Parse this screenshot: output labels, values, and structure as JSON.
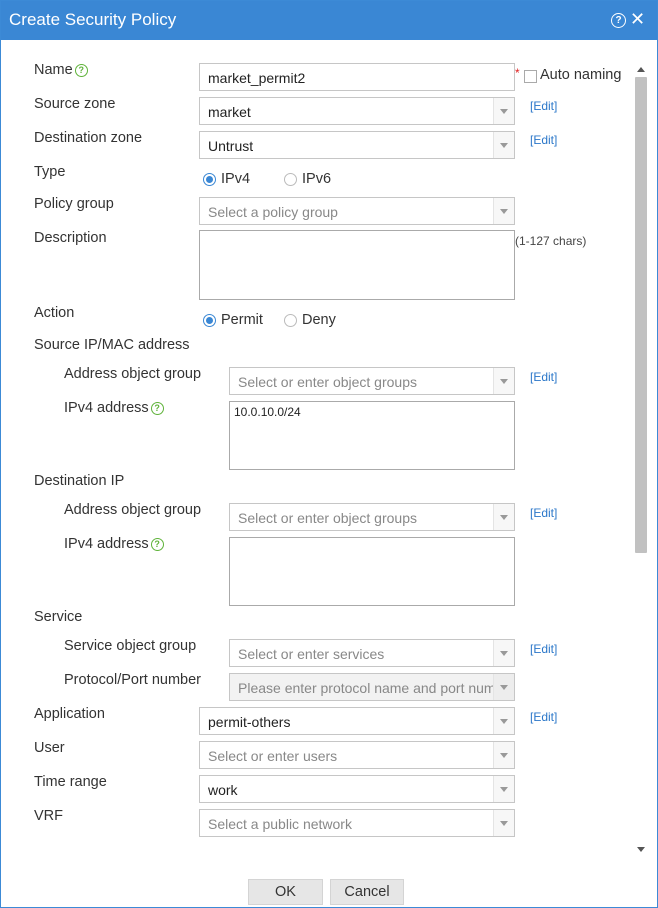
{
  "dialog": {
    "title": "Create Security Policy",
    "help_glyph": "?",
    "close_glyph": "✕"
  },
  "form": {
    "name": {
      "label": "Name",
      "value": "market_permit2",
      "required_mark": "*",
      "auto_naming_label": "Auto naming",
      "auto_naming_checked": false
    },
    "source_zone": {
      "label": "Source zone",
      "value": "market",
      "edit": "[Edit]"
    },
    "destination_zone": {
      "label": "Destination zone",
      "value": "Untrust",
      "edit": "[Edit]"
    },
    "type": {
      "label": "Type",
      "options": [
        "IPv4",
        "IPv6"
      ],
      "selected": "IPv4"
    },
    "policy_group": {
      "label": "Policy group",
      "placeholder": "Select a policy group"
    },
    "description": {
      "label": "Description",
      "value": "",
      "hint": "(1-127 chars)"
    },
    "action": {
      "label": "Action",
      "options": [
        "Permit",
        "Deny"
      ],
      "selected": "Permit"
    },
    "source_ip": {
      "section_label": "Source IP/MAC address",
      "address_object_group_label": "Address object group",
      "address_object_group_placeholder": "Select or enter object groups",
      "edit": "[Edit]",
      "ipv4_label": "IPv4 address",
      "ipv4_value": "10.0.10.0/24"
    },
    "destination_ip": {
      "section_label": "Destination IP",
      "address_object_group_label": "Address object group",
      "address_object_group_placeholder": "Select or enter object groups",
      "edit": "[Edit]",
      "ipv4_label": "IPv4 address",
      "ipv4_value": ""
    },
    "service": {
      "section_label": "Service",
      "service_object_group_label": "Service object group",
      "service_object_group_placeholder": "Select or enter services",
      "edit": "[Edit]",
      "protocol_label": "Protocol/Port number",
      "protocol_placeholder": "Please enter protocol name and port num"
    },
    "application": {
      "label": "Application",
      "value": "permit-others",
      "edit": "[Edit]"
    },
    "user": {
      "label": "User",
      "placeholder": "Select or enter users"
    },
    "time_range": {
      "label": "Time range",
      "value": "work"
    },
    "vrf": {
      "label": "VRF",
      "placeholder": "Select a public network"
    }
  },
  "buttons": {
    "ok": "OK",
    "cancel": "Cancel"
  },
  "colors": {
    "titlebar": "#3a87d4",
    "link": "#2b77c9",
    "help_icon": "#5fb33a",
    "required": "#e02020"
  }
}
